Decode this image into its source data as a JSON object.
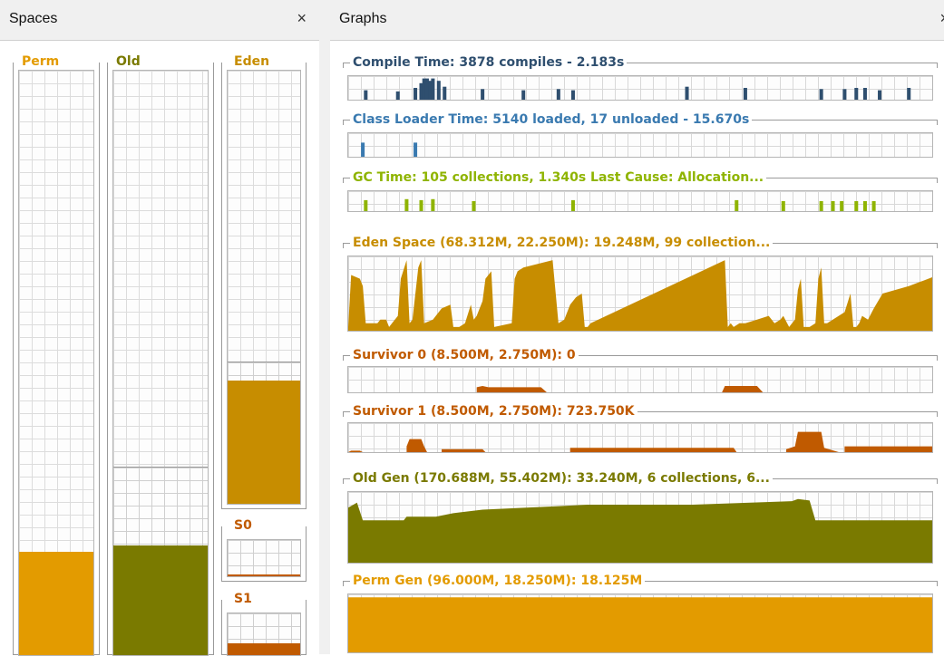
{
  "spaces_panel": {
    "title": "Spaces",
    "close": "×"
  },
  "graphs_panel": {
    "title": "Graphs",
    "close": "×"
  },
  "spaces": [
    {
      "id": "perm",
      "label": "Perm",
      "color": "#e39b00",
      "used_fraction": 0.173,
      "committed_fraction": 0.173
    },
    {
      "id": "old",
      "label": "Old",
      "color": "#7a7a00",
      "used_fraction": 0.185,
      "committed_fraction": 0.321
    },
    {
      "id": "eden",
      "label": "Eden",
      "color": "#c78d00",
      "used_fraction": 0.281,
      "committed_fraction": 0.326
    },
    {
      "id": "s0",
      "label": "S0",
      "color": "#c05a00",
      "used_fraction": 0.0,
      "committed_fraction": 1.0
    },
    {
      "id": "s1",
      "label": "S1",
      "color": "#c05a00",
      "used_fraction": 0.25,
      "committed_fraction": 1.0
    }
  ],
  "graphs": [
    {
      "id": "compile",
      "title": "Compile Time: 3878 compiles - 2.183s",
      "color": "#2f4f6f",
      "spikes": [
        0.03,
        0.085,
        0.115,
        0.125,
        0.13,
        0.135,
        0.14,
        0.145,
        0.155,
        0.165,
        0.23,
        0.3,
        0.36,
        0.385,
        0.58,
        0.68,
        0.81,
        0.85,
        0.87,
        0.885,
        0.91,
        0.96
      ],
      "heights": [
        0.4,
        0.35,
        0.5,
        0.7,
        0.9,
        0.9,
        0.8,
        0.9,
        0.8,
        0.55,
        0.45,
        0.4,
        0.45,
        0.4,
        0.55,
        0.5,
        0.45,
        0.45,
        0.5,
        0.5,
        0.4,
        0.5
      ]
    },
    {
      "id": "classloader",
      "title": "Class Loader Time: 5140 loaded, 17 unloaded - 15.670s",
      "color": "#3a7ab0",
      "spikes": [
        0.025,
        0.115
      ],
      "heights": [
        0.6,
        0.6
      ]
    },
    {
      "id": "gc",
      "title": "GC Time: 105 collections, 1.340s  Last Cause: Allocation...",
      "color": "#8fb400",
      "spikes": [
        0.03,
        0.1,
        0.125,
        0.145,
        0.215,
        0.385,
        0.665,
        0.745,
        0.81,
        0.83,
        0.845,
        0.87,
        0.885,
        0.9
      ],
      "heights": [
        0.55,
        0.6,
        0.55,
        0.6,
        0.5,
        0.55,
        0.55,
        0.5,
        0.5,
        0.5,
        0.5,
        0.5,
        0.5,
        0.5
      ]
    },
    {
      "id": "eden",
      "title": "Eden Space (68.312M, 22.250M): 19.248M, 99 collection...",
      "color": "#c78d00",
      "series": [
        [
          0,
          0.05
        ],
        [
          0.005,
          0.75
        ],
        [
          0.02,
          0.7
        ],
        [
          0.025,
          0.6
        ],
        [
          0.03,
          0.1
        ],
        [
          0.05,
          0.1
        ],
        [
          0.055,
          0.15
        ],
        [
          0.065,
          0.15
        ],
        [
          0.07,
          0.05
        ],
        [
          0.075,
          0.1
        ],
        [
          0.085,
          0.2
        ],
        [
          0.09,
          0.7
        ],
        [
          0.1,
          0.95
        ],
        [
          0.105,
          0.1
        ],
        [
          0.11,
          0.15
        ],
        [
          0.12,
          0.85
        ],
        [
          0.125,
          0.95
        ],
        [
          0.13,
          0.1
        ],
        [
          0.145,
          0.15
        ],
        [
          0.16,
          0.3
        ],
        [
          0.175,
          0.35
        ],
        [
          0.18,
          0.05
        ],
        [
          0.19,
          0.05
        ],
        [
          0.2,
          0.1
        ],
        [
          0.21,
          0.35
        ],
        [
          0.215,
          0.15
        ],
        [
          0.22,
          0.2
        ],
        [
          0.23,
          0.4
        ],
        [
          0.235,
          0.7
        ],
        [
          0.245,
          0.8
        ],
        [
          0.25,
          0.05
        ],
        [
          0.28,
          0.1
        ],
        [
          0.285,
          0.7
        ],
        [
          0.29,
          0.8
        ],
        [
          0.3,
          0.85
        ],
        [
          0.35,
          0.95
        ],
        [
          0.36,
          0.1
        ],
        [
          0.37,
          0.15
        ],
        [
          0.38,
          0.35
        ],
        [
          0.39,
          0.45
        ],
        [
          0.4,
          0.5
        ],
        [
          0.405,
          0.05
        ],
        [
          0.41,
          0.05
        ],
        [
          0.415,
          0.1
        ],
        [
          0.645,
          0.95
        ],
        [
          0.65,
          0.05
        ],
        [
          0.655,
          0.1
        ],
        [
          0.66,
          0.05
        ],
        [
          0.67,
          0.1
        ],
        [
          0.68,
          0.1
        ],
        [
          0.7,
          0.15
        ],
        [
          0.72,
          0.2
        ],
        [
          0.73,
          0.1
        ],
        [
          0.74,
          0.15
        ],
        [
          0.745,
          0.2
        ],
        [
          0.755,
          0.05
        ],
        [
          0.76,
          0.1
        ],
        [
          0.765,
          0.15
        ],
        [
          0.77,
          0.55
        ],
        [
          0.775,
          0.7
        ],
        [
          0.78,
          0.05
        ],
        [
          0.79,
          0.05
        ],
        [
          0.8,
          0.1
        ],
        [
          0.805,
          0.7
        ],
        [
          0.81,
          0.85
        ],
        [
          0.815,
          0.1
        ],
        [
          0.82,
          0.1
        ],
        [
          0.85,
          0.25
        ],
        [
          0.86,
          0.5
        ],
        [
          0.865,
          0.05
        ],
        [
          0.87,
          0.05
        ],
        [
          0.875,
          0.1
        ],
        [
          0.88,
          0.2
        ],
        [
          0.89,
          0.15
        ],
        [
          0.9,
          0.3
        ],
        [
          0.915,
          0.5
        ],
        [
          0.96,
          0.6
        ],
        [
          1.0,
          0.72
        ],
        [
          1.0,
          0.05
        ]
      ]
    },
    {
      "id": "s0",
      "title": "Survivor 0 (8.500M, 2.750M): 0",
      "color": "#c05a00",
      "series": [
        [
          0,
          0
        ],
        [
          0.22,
          0
        ],
        [
          0.22,
          0.2
        ],
        [
          0.23,
          0.25
        ],
        [
          0.24,
          0.2
        ],
        [
          0.33,
          0.2
        ],
        [
          0.34,
          0
        ],
        [
          0.64,
          0
        ],
        [
          0.645,
          0.25
        ],
        [
          0.7,
          0.25
        ],
        [
          0.71,
          0
        ],
        [
          1,
          0
        ]
      ]
    },
    {
      "id": "s1",
      "title": "Survivor 1 (8.500M, 2.750M): 723.750K",
      "color": "#c05a00",
      "series": [
        [
          0,
          0
        ],
        [
          0.005,
          0.05
        ],
        [
          0.02,
          0.05
        ],
        [
          0.025,
          0
        ],
        [
          0.1,
          0
        ],
        [
          0.1,
          0.2
        ],
        [
          0.105,
          0.45
        ],
        [
          0.125,
          0.45
        ],
        [
          0.13,
          0.2
        ],
        [
          0.135,
          0
        ],
        [
          0.16,
          0
        ],
        [
          0.16,
          0.1
        ],
        [
          0.23,
          0.1
        ],
        [
          0.235,
          0
        ],
        [
          0.38,
          0
        ],
        [
          0.38,
          0.15
        ],
        [
          0.66,
          0.15
        ],
        [
          0.665,
          0
        ],
        [
          0.75,
          0
        ],
        [
          0.75,
          0.1
        ],
        [
          0.765,
          0.2
        ],
        [
          0.77,
          0.7
        ],
        [
          0.81,
          0.7
        ],
        [
          0.815,
          0.15
        ],
        [
          0.84,
          0
        ],
        [
          0.85,
          0
        ],
        [
          0.85,
          0.2
        ],
        [
          1,
          0.2
        ],
        [
          1,
          0
        ]
      ]
    },
    {
      "id": "old",
      "title": "Old Gen (170.688M, 55.402M): 33.240M, 6 collections, 6...",
      "color": "#7a7a00",
      "series": [
        [
          0,
          0.78
        ],
        [
          0.015,
          0.85
        ],
        [
          0.025,
          0.6
        ],
        [
          0.095,
          0.6
        ],
        [
          0.1,
          0.65
        ],
        [
          0.15,
          0.65
        ],
        [
          0.18,
          0.7
        ],
        [
          0.23,
          0.75
        ],
        [
          0.36,
          0.8
        ],
        [
          0.41,
          0.82
        ],
        [
          0.59,
          0.82
        ],
        [
          0.76,
          0.87
        ],
        [
          0.77,
          0.9
        ],
        [
          0.79,
          0.88
        ],
        [
          0.8,
          0.6
        ],
        [
          0.99,
          0.6
        ],
        [
          1,
          0.6
        ],
        [
          1,
          0
        ]
      ]
    },
    {
      "id": "perm",
      "title": "Perm Gen (96.000M, 18.250M): 18.125M",
      "color": "#e39b00",
      "series": [
        [
          0,
          0.95
        ],
        [
          1,
          0.95
        ],
        [
          1,
          0
        ]
      ]
    }
  ]
}
